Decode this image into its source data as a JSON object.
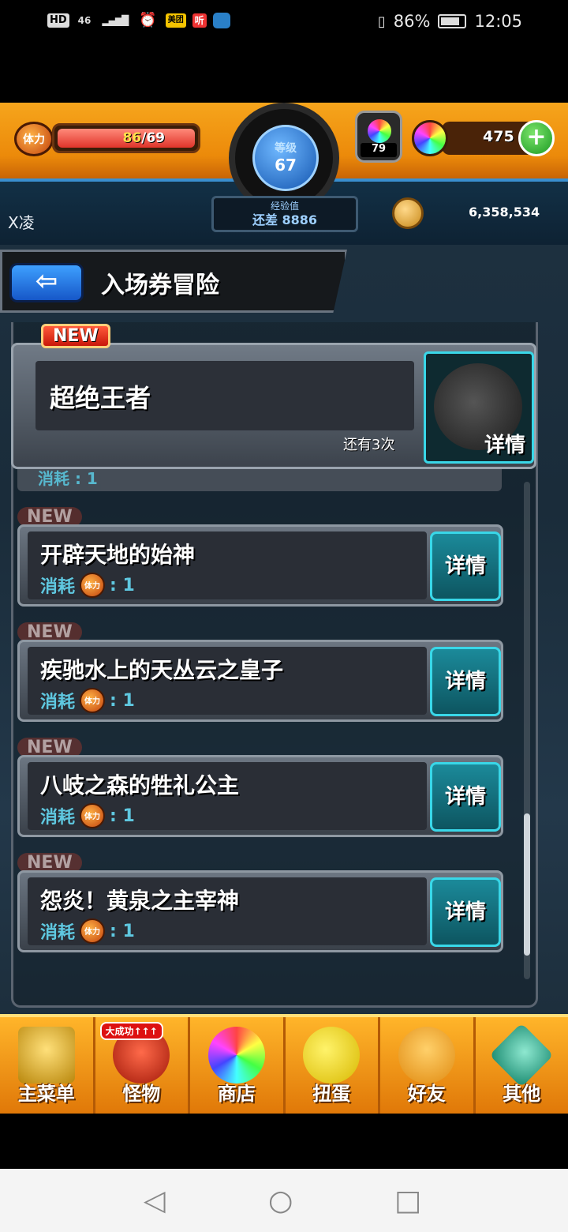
{
  "status_bar": {
    "hd": "HD",
    "signal": "46",
    "signal_bars": "▂▄▆█",
    "app_meituan": "美团",
    "app_ting": "听",
    "battery_percent": "86%",
    "time": "12:05"
  },
  "player": {
    "stamina_current": "86",
    "stamina_max": "/69",
    "stamina_label": "体力",
    "stamina_fill": 1.0,
    "level_label": "等级",
    "level": "67",
    "exp_label": "经验值",
    "exp_remaining": "还差 8886",
    "egg_count": "79",
    "orb_count": "475",
    "name": "X凌",
    "coins": "6,358,534"
  },
  "header": {
    "back_arrow": "⇦",
    "title": "入场券冒险"
  },
  "featured": {
    "badge": "NEW",
    "title": "超绝王者",
    "remaining": "还有3次",
    "details_label": "详情"
  },
  "partial_row": {
    "cost_label": "消耗",
    "cost_value": ": 1"
  },
  "quests": [
    {
      "badge": "NEW",
      "title": "开辟天地的始神",
      "cost_label": "消耗",
      "stamina_label": "体力",
      "cost_value": ": 1",
      "details_label": "详情"
    },
    {
      "badge": "NEW",
      "title": "疾驰水上的天丛云之皇子",
      "cost_label": "消耗",
      "stamina_label": "体力",
      "cost_value": ": 1",
      "details_label": "详情"
    },
    {
      "badge": "NEW",
      "title": "八岐之森的牲礼公主",
      "cost_label": "消耗",
      "stamina_label": "体力",
      "cost_value": ": 1",
      "details_label": "详情"
    },
    {
      "badge": "NEW",
      "title": "怨炎！黄泉之主宰神",
      "cost_label": "消耗",
      "stamina_label": "体力",
      "cost_value": ": 1",
      "details_label": "详情"
    }
  ],
  "bottom_nav": {
    "items": [
      {
        "label": "主菜单",
        "icon": "castle-icon"
      },
      {
        "label": "怪物",
        "icon": "monster-icon",
        "badge": "大成功↑↑↑"
      },
      {
        "label": "商店",
        "icon": "orb-icon"
      },
      {
        "label": "扭蛋",
        "icon": "egg-icon"
      },
      {
        "label": "好友",
        "icon": "friends-icon"
      },
      {
        "label": "其他",
        "icon": "other-icon"
      }
    ]
  },
  "android_nav": {
    "back": "◁",
    "home": "○",
    "recent": "□"
  },
  "colors": {
    "accent_orange": "#f6a51c",
    "cyan": "#39d7e8",
    "new_red": "#e0342a"
  }
}
